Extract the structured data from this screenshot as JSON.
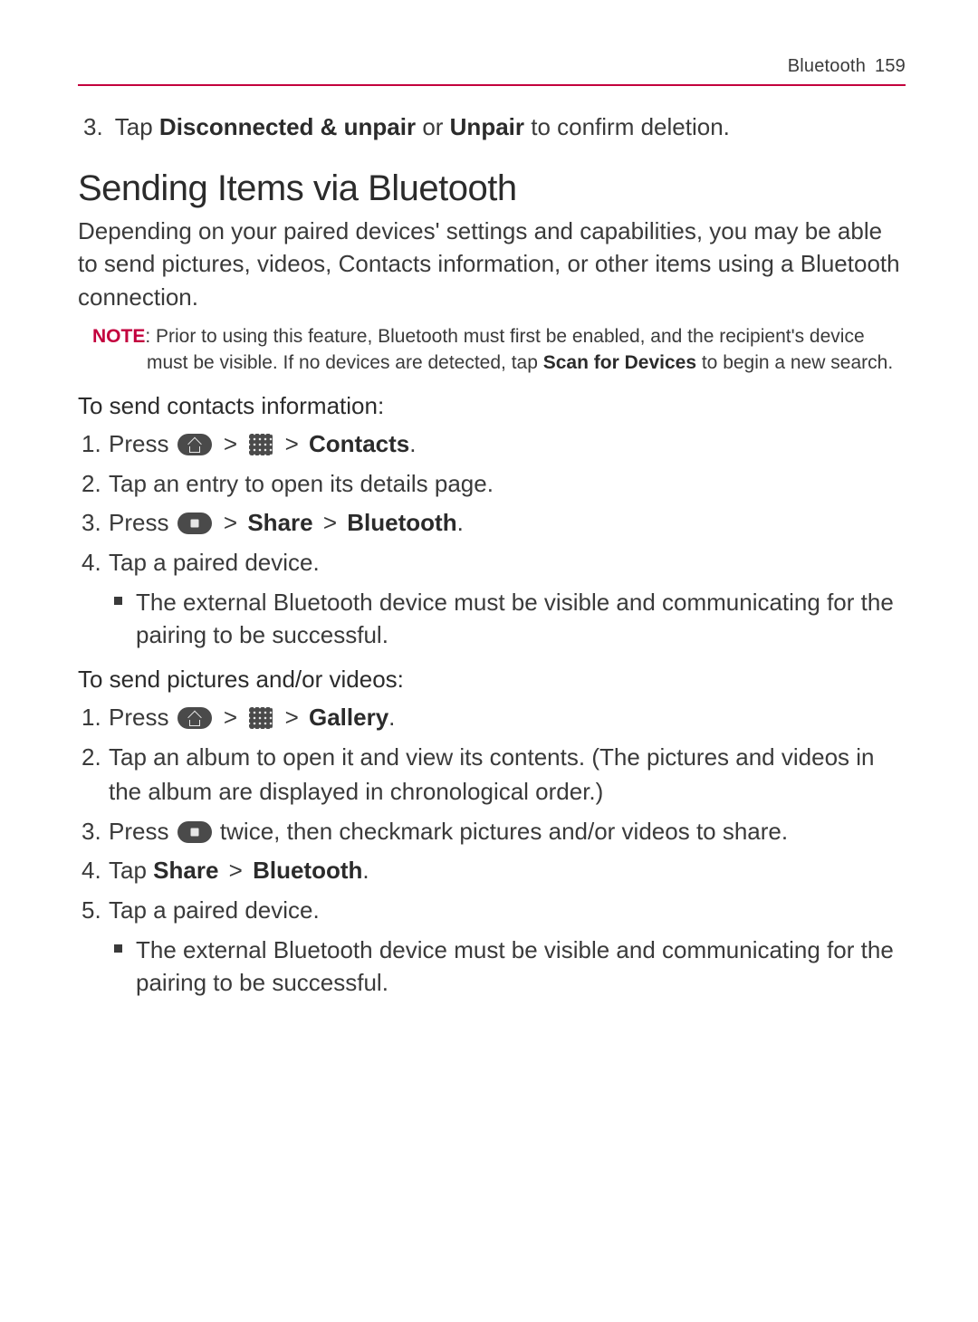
{
  "header": {
    "section": "Bluetooth",
    "page": "159"
  },
  "prelude_step": {
    "num": "3.",
    "pre": "Tap ",
    "b1": "Disconnected & unpair",
    "mid": " or ",
    "b2": "Unpair",
    "post": " to confirm deletion."
  },
  "section_title": "Sending Items via Bluetooth",
  "intro": "Depending on your paired devices' settings and capabilities, you may be able to send pictures, videos, Contacts information, or other items using a Bluetooth connection.",
  "note": {
    "label": "NOTE",
    "pre": ": Prior to using this feature, Bluetooth must first be enabled, and the recipient's device must be visible. If no devices are detected, tap ",
    "bold": "Scan for Devices",
    "post": " to begin a new search."
  },
  "contacts": {
    "heading": "To send contacts information:",
    "s1_pre": "Press ",
    "s1_bold": "Contacts",
    "s1_post": ".",
    "s2": "Tap an entry to open its details page.",
    "s3_pre": "Press ",
    "s3_b1": "Share",
    "s3_b2": "Bluetooth",
    "s3_post": ".",
    "s4": "Tap a paired device.",
    "s4_bullet": "The external Bluetooth device must be visible and communicating for the pairing to be successful."
  },
  "media": {
    "heading": "To send pictures and/or videos:",
    "s1_pre": "Press ",
    "s1_bold": "Gallery",
    "s1_post": ".",
    "s2": "Tap an album to open it and view its contents. (The pictures and videos in the album are displayed in chronological order.)",
    "s3_pre": "Press ",
    "s3_post": " twice, then checkmark pictures and/or videos to share.",
    "s4_pre": "Tap ",
    "s4_b1": "Share",
    "s4_b2": "Bluetooth",
    "s4_post": ".",
    "s5": "Tap a paired device.",
    "s5_bullet": "The external Bluetooth device must be visible and communicating for the pairing to be successful."
  },
  "glyphs": {
    "gt": ">"
  }
}
